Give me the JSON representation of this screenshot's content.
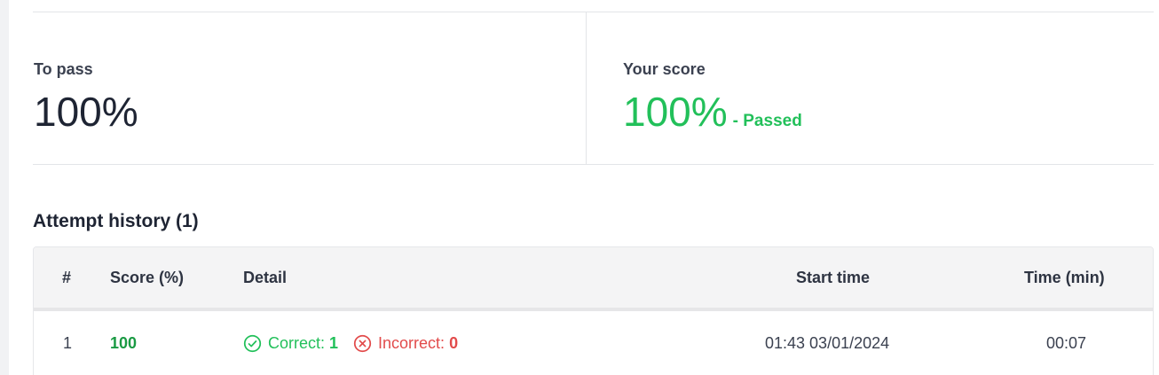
{
  "summary": {
    "to_pass_label": "To pass",
    "to_pass_value": "100%",
    "your_score_label": "Your score",
    "your_score_value": "100%",
    "your_score_status": "- Passed"
  },
  "history": {
    "title": "Attempt history (1)",
    "columns": [
      "#",
      "Score (%)",
      "Detail",
      "Start time",
      "Time (min)"
    ],
    "rows": [
      {
        "number": "1",
        "score": "100",
        "correct_label": "Correct:",
        "correct_count": "1",
        "incorrect_label": "Incorrect:",
        "incorrect_count": "0",
        "start_time": "01:43 03/01/2024",
        "duration": "00:07"
      }
    ]
  },
  "icons": {
    "correct": "check-circle-icon",
    "incorrect": "x-circle-icon"
  },
  "colors": {
    "pass_green": "#22c05a",
    "score_green": "#1a9a43",
    "error_red": "#e24b4b",
    "text_dark": "#1e2433"
  }
}
